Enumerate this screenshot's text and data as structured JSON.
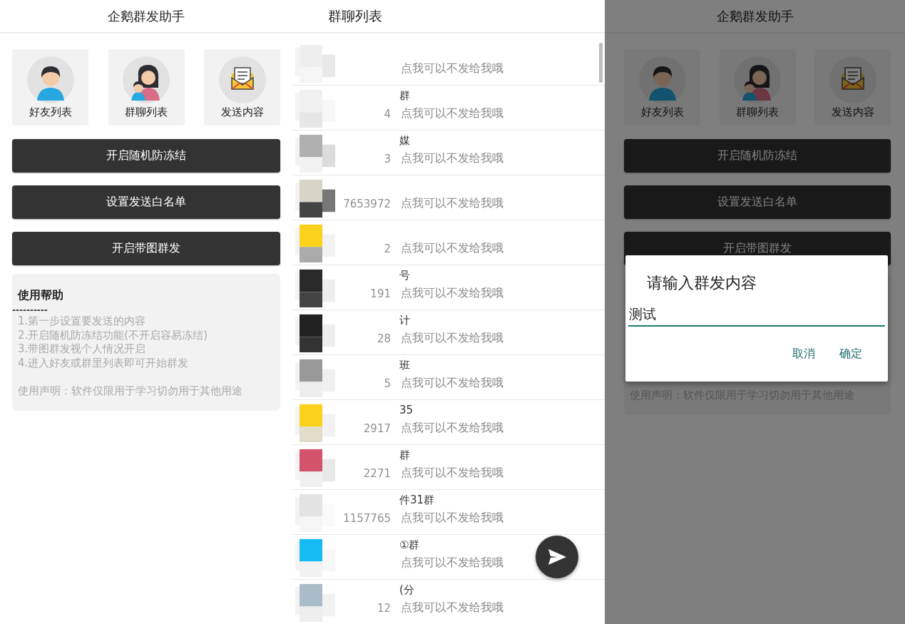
{
  "left": {
    "title": "企鹅群发助手",
    "tiles": [
      {
        "label": "好友列表",
        "kind": "friend"
      },
      {
        "label": "群聊列表",
        "kind": "group"
      },
      {
        "label": "发送内容",
        "kind": "message"
      }
    ],
    "buttons": [
      "开启随机防冻结",
      "设置发送白名单",
      "开启带图群发"
    ],
    "help": {
      "title": "使用帮助",
      "divider": "----------",
      "lines": [
        "1.第一步设置要发送的内容",
        "2.开启随机防冻结功能(不开启容易冻结)",
        "3.带图群发视个人情况开启",
        "4.进入好友或群里列表即可开始群发"
      ],
      "notice": "使用声明：软件仅限用于学习切勿用于其他用途"
    }
  },
  "middle": {
    "title": "群聊列表",
    "groups": [
      {
        "hint": "点我可以不发给我哦"
      },
      {
        "name": "群",
        "number": "4",
        "hint": "点我可以不发给我哦"
      },
      {
        "name": "媒",
        "number": "3",
        "hint": "点我可以不发给我哦"
      },
      {
        "number": "7653972",
        "hint": "点我可以不发给我哦"
      },
      {
        "number": "2",
        "hint": "点我可以不发给我哦"
      },
      {
        "name": "号",
        "number": "191",
        "hint": "点我可以不发给我哦"
      },
      {
        "name": "计",
        "number": "28",
        "hint": "点我可以不发给我哦"
      },
      {
        "name": "班",
        "number": "5",
        "hint": "点我可以不发给我哦"
      },
      {
        "name": "35",
        "number": "2917",
        "hint": "点我可以不发给我哦"
      },
      {
        "name": "群",
        "number": "2271",
        "hint": "点我可以不发给我哦"
      },
      {
        "name": "件31群",
        "number": "1157765",
        "hint": "点我可以不发给我哦"
      },
      {
        "name": "①群",
        "hint": "点我可以不发给我哦"
      },
      {
        "name": "(分",
        "number": "12",
        "hint": "点我可以不发给我哦"
      }
    ]
  },
  "right": {
    "title": "企鹅群发助手",
    "tiles": [
      {
        "label": "好友列表",
        "kind": "friend"
      },
      {
        "label": "群聊列表",
        "kind": "group"
      },
      {
        "label": "发送内容",
        "kind": "message"
      }
    ],
    "buttons": [
      "开启随机防冻结",
      "设置发送白名单",
      "开启带图群发"
    ],
    "notice": "使用声明：软件仅限用于学习切勿用于其他用途",
    "dialog": {
      "title": "请输入群发内容",
      "value": "测试",
      "buttons": [
        "取消",
        "确定"
      ]
    }
  }
}
